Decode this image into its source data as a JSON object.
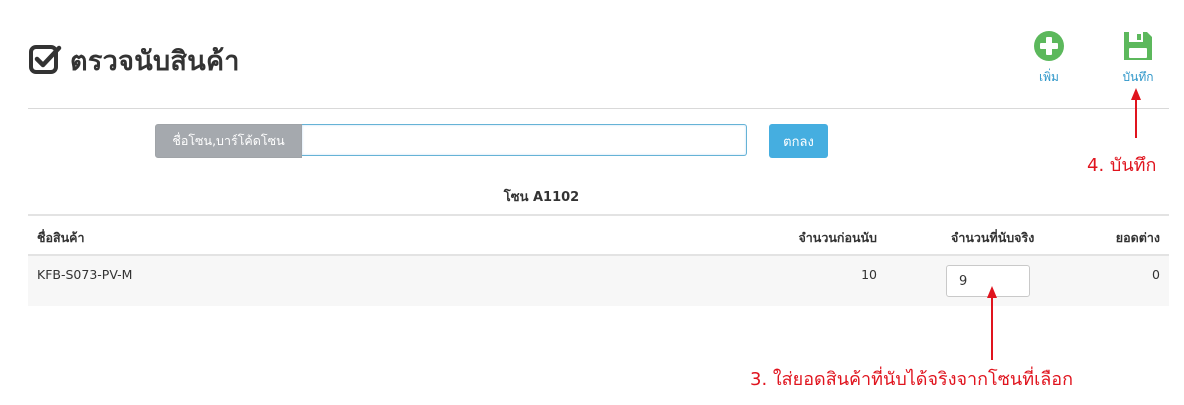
{
  "page": {
    "title": "ตรวจนับสินค้า",
    "title_icon": "check-square-icon"
  },
  "toolbar": {
    "add_label": "เพิ่ม",
    "add_icon": "plus-circle-icon",
    "save_label": "บันทึก",
    "save_icon": "floppy-disk-icon"
  },
  "search": {
    "addon_label": "ชื่อโซน,บาร์โค้ดโซน",
    "value": "",
    "placeholder": ""
  },
  "ok_button": {
    "label": "ตกลง"
  },
  "zone": {
    "title": "โซน A1102"
  },
  "table": {
    "headers": {
      "name": "ชื่อสินค้า",
      "before": "จำนวนก่อนนับ",
      "counted": "จำนวนที่นับจริง",
      "diff": "ยอดต่าง"
    },
    "rows": [
      {
        "name": "KFB-S073-PV-M",
        "before": "10",
        "counted": "9",
        "diff": "0"
      }
    ]
  },
  "annotations": {
    "step4": "4. บันทึก",
    "step3": "3. ใส่ยอดสินค้าที่นับได้จริงจากโซนที่เลือก"
  },
  "colors": {
    "accent": "#45aee0",
    "icon_green": "#5cb85c",
    "annotation_red": "#e0141e",
    "link_blue": "#2f97c9"
  }
}
